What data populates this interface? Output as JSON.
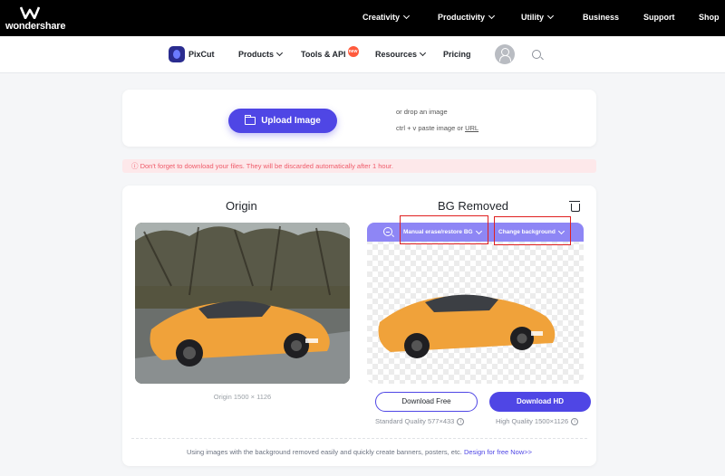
{
  "topbar": {
    "brand": "wondershare",
    "nav": [
      {
        "label": "Creativity",
        "dropdown": true
      },
      {
        "label": "Productivity",
        "dropdown": true
      },
      {
        "label": "Utility",
        "dropdown": true
      },
      {
        "label": "Business",
        "dropdown": false
      },
      {
        "label": "Support",
        "dropdown": false
      },
      {
        "label": "Shop",
        "dropdown": false
      }
    ]
  },
  "subnav": {
    "product_name": "PixCut",
    "links": {
      "products": "Products",
      "tools": "Tools & API",
      "tools_badge": "new",
      "resources": "Resources",
      "pricing": "Pricing"
    },
    "icons": {
      "avatar": "user-icon",
      "search": "search-icon"
    }
  },
  "upload": {
    "button_label": "Upload Image",
    "drop_text": "or drop an image",
    "paste_prefix": "ctrl + v paste image or ",
    "paste_link": "URL"
  },
  "warning": "ⓘ Don't forget to download your files. They will be discarded automatically after 1 hour.",
  "result": {
    "origin_title": "Origin",
    "origin_meta": "Origin 1500 × 1126",
    "removed_title": "BG Removed",
    "toolbar": {
      "manual": "Manual erase/restore BG",
      "change_bg": "Change background"
    },
    "download_free": "Download Free",
    "download_hd": "Download HD",
    "standard_quality": "Standard Quality 577×433",
    "high_quality": "High Quality 1500×1126",
    "promo_text": "Using images with the background removed easily and quickly create banners, posters, etc. ",
    "promo_link": "Design for free Now>>"
  },
  "colors": {
    "accent": "#4f46e5",
    "toolbar": "#8e86f5",
    "warning_bg": "#fde8ea",
    "warning_text": "#ef5b6a",
    "annotation_red": "#e02020",
    "car_orange": "#f0a23a"
  }
}
